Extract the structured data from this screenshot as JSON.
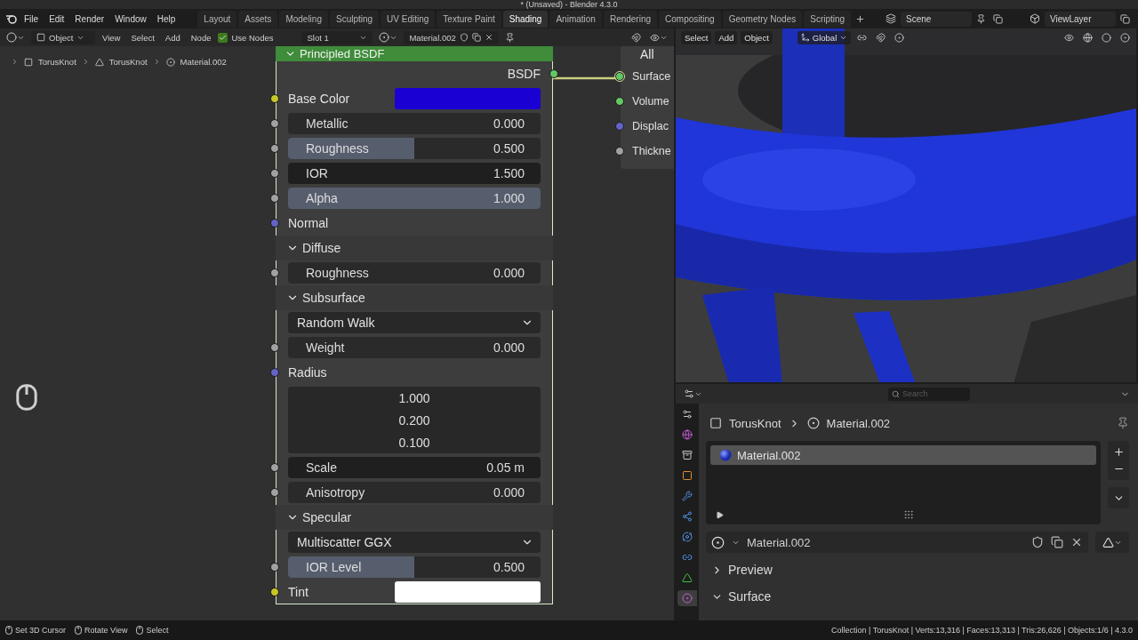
{
  "window": {
    "title": "* (Unsaved) - Blender 4.3.0"
  },
  "menu": [
    "File",
    "Edit",
    "Render",
    "Window",
    "Help"
  ],
  "workspaces": [
    {
      "label": "Layout",
      "selected": false
    },
    {
      "label": "Assets",
      "selected": false
    },
    {
      "label": "Modeling",
      "selected": false
    },
    {
      "label": "Sculpting",
      "selected": false
    },
    {
      "label": "UV Editing",
      "selected": false
    },
    {
      "label": "Texture Paint",
      "selected": false
    },
    {
      "label": "Shading",
      "selected": true
    },
    {
      "label": "Animation",
      "selected": false
    },
    {
      "label": "Rendering",
      "selected": false
    },
    {
      "label": "Compositing",
      "selected": false
    },
    {
      "label": "Geometry Nodes",
      "selected": false
    },
    {
      "label": "Scripting",
      "selected": false
    }
  ],
  "scene": "Scene",
  "view_layer": "ViewLayer",
  "node_editor": {
    "mode": "Object",
    "menus": [
      "View",
      "Select",
      "Add",
      "Node"
    ],
    "use_nodes": {
      "label": "Use Nodes",
      "checked": true
    },
    "slot": "Slot 1",
    "material": "Material.002",
    "breadcrumb": [
      "TorusKnot",
      "TorusKnot",
      "Material.002"
    ],
    "node": {
      "title": "Principled BSDF",
      "rows": [
        {
          "kind": "output",
          "label": "BSDF"
        },
        {
          "kind": "color",
          "socket": {
            "color": "#c7c729"
          },
          "label": "Base Color",
          "color": "#1a00d2"
        },
        {
          "kind": "slider",
          "socket": {
            "color": "#a1a1a1"
          },
          "label": "Metallic",
          "value": "0.000",
          "level": 0
        },
        {
          "kind": "slider",
          "socket": {
            "color": "#a1a1a1"
          },
          "label": "Roughness",
          "value": "0.500",
          "level": 0.5
        },
        {
          "kind": "field",
          "socket": {
            "color": "#a1a1a1"
          },
          "label": "IOR",
          "value": "1.500"
        },
        {
          "kind": "slider",
          "socket": {
            "color": "#a1a1a1"
          },
          "label": "Alpha",
          "value": "1.000",
          "level": 1
        },
        {
          "kind": "label",
          "socket": {
            "color": "#6363c7"
          },
          "label": "Normal"
        },
        {
          "kind": "panel",
          "label": "Diffuse",
          "expanded": true
        },
        {
          "kind": "slider",
          "socket": {
            "color": "#a1a1a1"
          },
          "label": "Roughness",
          "value": "0.000",
          "level": 0
        },
        {
          "kind": "panel",
          "label": "Subsurface",
          "expanded": true
        },
        {
          "kind": "dropdown",
          "value": "Random Walk"
        },
        {
          "kind": "slider",
          "socket": {
            "color": "#a1a1a1"
          },
          "label": "Weight",
          "value": "0.000",
          "level": 0
        },
        {
          "kind": "label",
          "socket": {
            "color": "#6363c7"
          },
          "label": "Radius"
        },
        {
          "kind": "vector",
          "values": [
            "1.000",
            "0.200",
            "0.100"
          ]
        },
        {
          "kind": "field",
          "socket": {
            "color": "#a1a1a1"
          },
          "label": "Scale",
          "value": "0.05 m"
        },
        {
          "kind": "slider",
          "socket": {
            "color": "#a1a1a1"
          },
          "label": "Anisotropy",
          "value": "0.000",
          "level": 0
        },
        {
          "kind": "panel",
          "label": "Specular",
          "expanded": true
        },
        {
          "kind": "dropdown",
          "value": "Multiscatter GGX"
        },
        {
          "kind": "slider",
          "socket": {
            "color": "#a1a1a1"
          },
          "label": "IOR Level",
          "value": "0.500",
          "level": 0.5
        },
        {
          "kind": "color",
          "socket": {
            "color": "#c7c729"
          },
          "label": "Tint",
          "color": "#ffffff"
        }
      ]
    },
    "output_node": {
      "target": "All",
      "sockets": [
        {
          "label": "Surface",
          "color": "#63c763",
          "connected": true
        },
        {
          "label": "Volume",
          "color": "#63c763",
          "connected": false
        },
        {
          "label": "Displac",
          "color": "#6363c7",
          "connected": false
        },
        {
          "label": "Thickne",
          "color": "#a1a1a1",
          "connected": false
        }
      ]
    }
  },
  "viewport": {
    "menus": [
      "Select",
      "Add",
      "Object"
    ],
    "orientation": "Global"
  },
  "properties": {
    "search": {
      "placeholder": "Search"
    },
    "tabs": [
      {
        "kind": "tool",
        "selected": false
      },
      {
        "kind": "world",
        "selected": false
      },
      {
        "kind": "collection",
        "selected": false
      },
      {
        "kind": "object",
        "selected": false
      },
      {
        "kind": "modifier",
        "selected": false
      },
      {
        "kind": "particles",
        "selected": false
      },
      {
        "kind": "physics",
        "selected": false
      },
      {
        "kind": "constraints",
        "selected": false
      },
      {
        "kind": "data",
        "selected": false
      },
      {
        "kind": "material",
        "selected": true
      }
    ],
    "breadcrumb": [
      "TorusKnot",
      "Material.002"
    ],
    "slots": [
      {
        "label": "Material.002",
        "selected": true
      }
    ],
    "material": "Material.002",
    "panels": [
      {
        "label": "Preview",
        "expanded": false
      },
      {
        "label": "Surface",
        "expanded": true
      }
    ]
  },
  "status_bar": {
    "hints": [
      "Set 3D Cursor",
      "Rotate View",
      "Select"
    ],
    "stats": "Collection | TorusKnot | Verts:13,316 | Faces:13,313 | Tris:26,626 | Objects:1/6 | 4.3.0"
  }
}
